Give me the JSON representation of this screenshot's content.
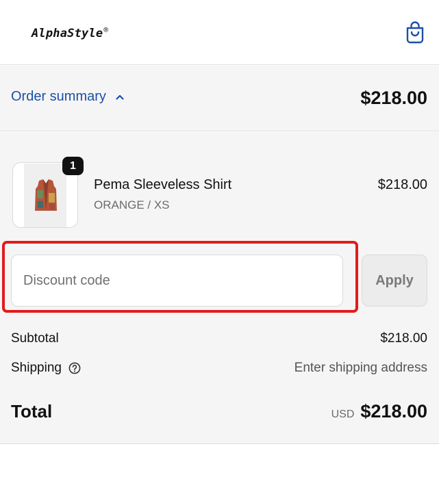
{
  "header": {
    "brand": "AlphaStyle",
    "brand_mark": "®",
    "cart_icon": "shopping-bag-icon"
  },
  "summary": {
    "toggle_label": "Order summary",
    "toggle_icon": "chevron-up-icon",
    "total": "$218.00"
  },
  "item": {
    "quantity": "1",
    "name": "Pema Sleeveless Shirt",
    "variant": "ORANGE / XS",
    "price": "$218.00"
  },
  "discount": {
    "placeholder": "Discount code",
    "value": "",
    "apply_label": "Apply"
  },
  "totals": {
    "subtotal_label": "Subtotal",
    "subtotal_value": "$218.00",
    "shipping_label": "Shipping",
    "shipping_help_icon": "question-circle-icon",
    "shipping_value": "Enter shipping address",
    "total_label": "Total",
    "currency": "USD",
    "total_value": "$218.00"
  },
  "colors": {
    "link": "#1c4fa8",
    "highlight": "#e31b1b",
    "panel_bg": "#f5f5f5"
  }
}
